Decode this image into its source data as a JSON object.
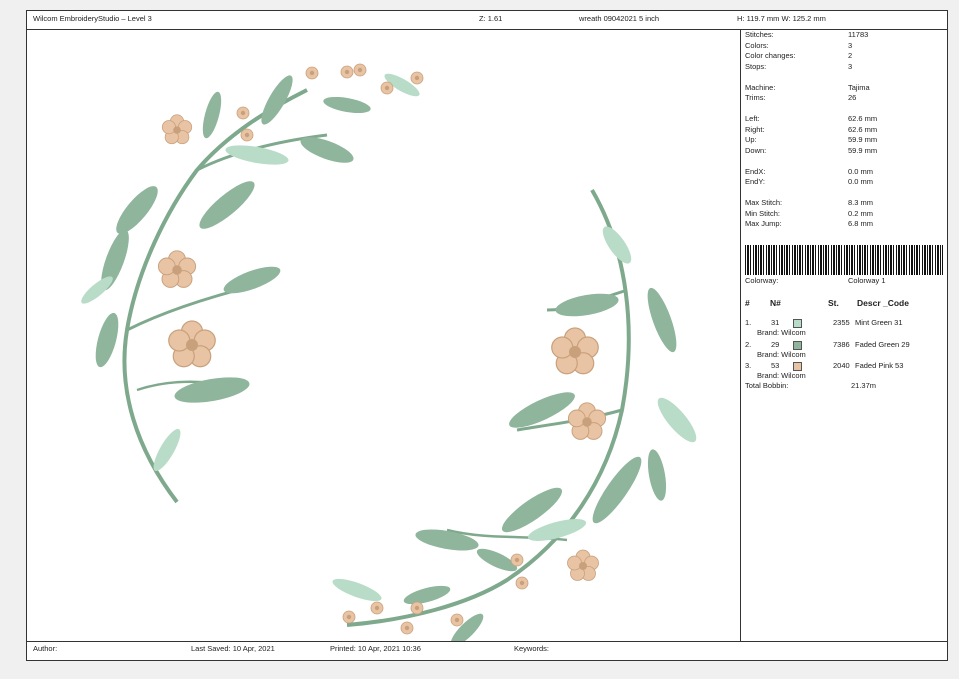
{
  "header": {
    "app_title": "Wilcom EmbroideryStudio – Level 3",
    "zoom": "Z: 1.61",
    "design_name": "wreath 09042021 5 inch",
    "dimensions": "H: 119.7 mm   W: 125.2 mm"
  },
  "stats": [
    {
      "label": "Stitches:",
      "value": "11783"
    },
    {
      "label": "Colors:",
      "value": "3"
    },
    {
      "label": "Color changes:",
      "value": "2"
    },
    {
      "label": "Stops:",
      "value": "3"
    },
    {
      "label": "Machine:",
      "value": "Tajima"
    },
    {
      "label": "Trims:",
      "value": "26"
    },
    {
      "label": "Left:",
      "value": "62.6 mm"
    },
    {
      "label": "Right:",
      "value": "62.6 mm"
    },
    {
      "label": "Up:",
      "value": "59.9 mm"
    },
    {
      "label": "Down:",
      "value": "59.9 mm"
    },
    {
      "label": "EndX:",
      "value": "0.0 mm"
    },
    {
      "label": "EndY:",
      "value": "0.0 mm"
    },
    {
      "label": "Max Stitch:",
      "value": "8.3 mm"
    },
    {
      "label": "Min Stitch:",
      "value": "0.2 mm"
    },
    {
      "label": "Max Jump:",
      "value": "6.8 mm"
    }
  ],
  "colorway": {
    "label": "Colorway:",
    "value": "Colorway 1"
  },
  "color_table": {
    "headers": {
      "num": "#",
      "n": "N#",
      "st": "St.",
      "descr": "Descr _Code"
    },
    "rows": [
      {
        "idx": "1.",
        "n": "31",
        "st": "2355",
        "descr": "Mint Green 31",
        "brand": "Brand: Wilcom",
        "color": "#b8dcc8"
      },
      {
        "idx": "2.",
        "n": "29",
        "st": "7386",
        "descr": "Faded Green 29",
        "brand": "Brand: Wilcom",
        "color": "#8fb59c"
      },
      {
        "idx": "3.",
        "n": "53",
        "st": "2040",
        "descr": "Faded Pink 53",
        "brand": "Brand: Wilcom",
        "color": "#e8c4a4"
      }
    ],
    "total_bobbin": {
      "label": "Total Bobbin:",
      "value": "21.37m"
    }
  },
  "footer": {
    "author": "Author:",
    "last_saved": "Last Saved: 10 Apr, 2021",
    "printed": "Printed: 10 Apr, 2021 10:36",
    "keywords": "Keywords:"
  },
  "colors": {
    "leaf_dark": "#8fb59c",
    "leaf_light": "#b8dcc8",
    "stem": "#7fa98d",
    "flower": "#e8c4a4",
    "flower_center": "#c9a07c"
  }
}
